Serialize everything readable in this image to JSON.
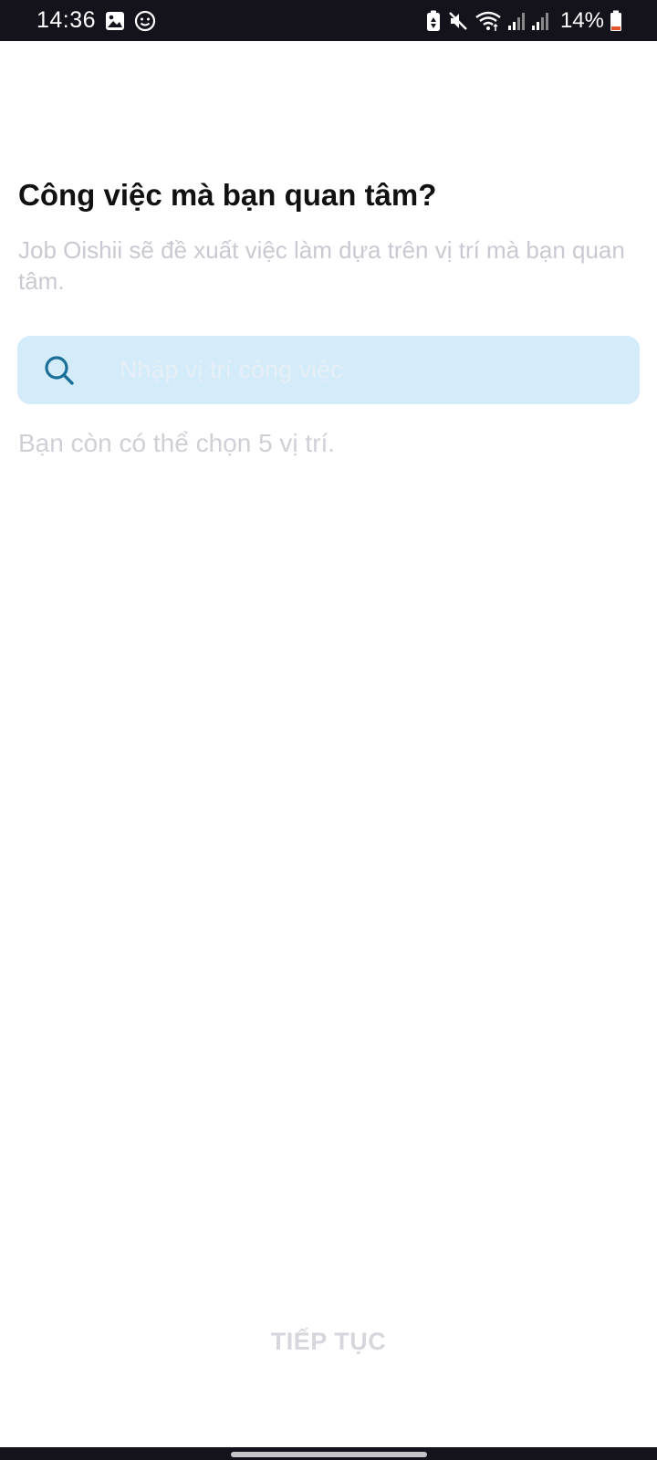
{
  "status_bar": {
    "time": "14:36",
    "battery_text": "14%",
    "left_icons": [
      "gallery-icon",
      "face-icon"
    ],
    "right_icons": [
      "battery-saver-icon",
      "mute-icon",
      "wifi-icon",
      "signal-icon",
      "signal-icon",
      "battery-icon"
    ]
  },
  "page": {
    "title": "Công việc mà bạn quan tâm?",
    "subtitle": "Job Oishii sẽ đề xuất việc làm dựa trên vị trí mà bạn quan tâm.",
    "search": {
      "placeholder": "Nhập vị trí công việc",
      "value": ""
    },
    "hint": "Bạn còn có thể chọn 5 vị trí.",
    "continue_label": "TIẾP TỤC"
  },
  "colors": {
    "accent": "#1a6f9a",
    "search_bg": "#d4ecf9",
    "status_bar_bg": "#14121a",
    "muted_text": "#c9c9d2",
    "battery_low": "#e4572e"
  }
}
